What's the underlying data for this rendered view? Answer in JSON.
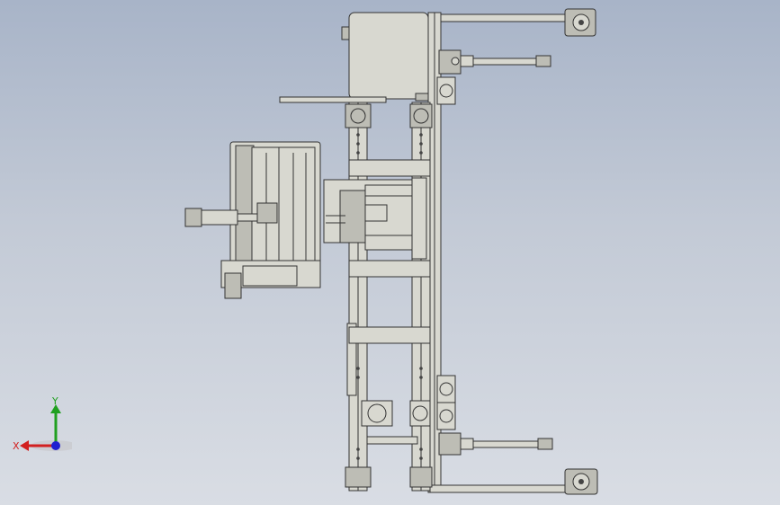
{
  "viewport": {
    "background_top": "#a8b4c8",
    "background_bottom": "#d9dde4",
    "part_fill": "#d6d6ce",
    "edge_color": "#3a3a3a"
  },
  "triad": {
    "x_label": "X",
    "y_label": "Y",
    "x_color": "#d22020",
    "y_color": "#20a020",
    "z_color": "#2020d0"
  }
}
